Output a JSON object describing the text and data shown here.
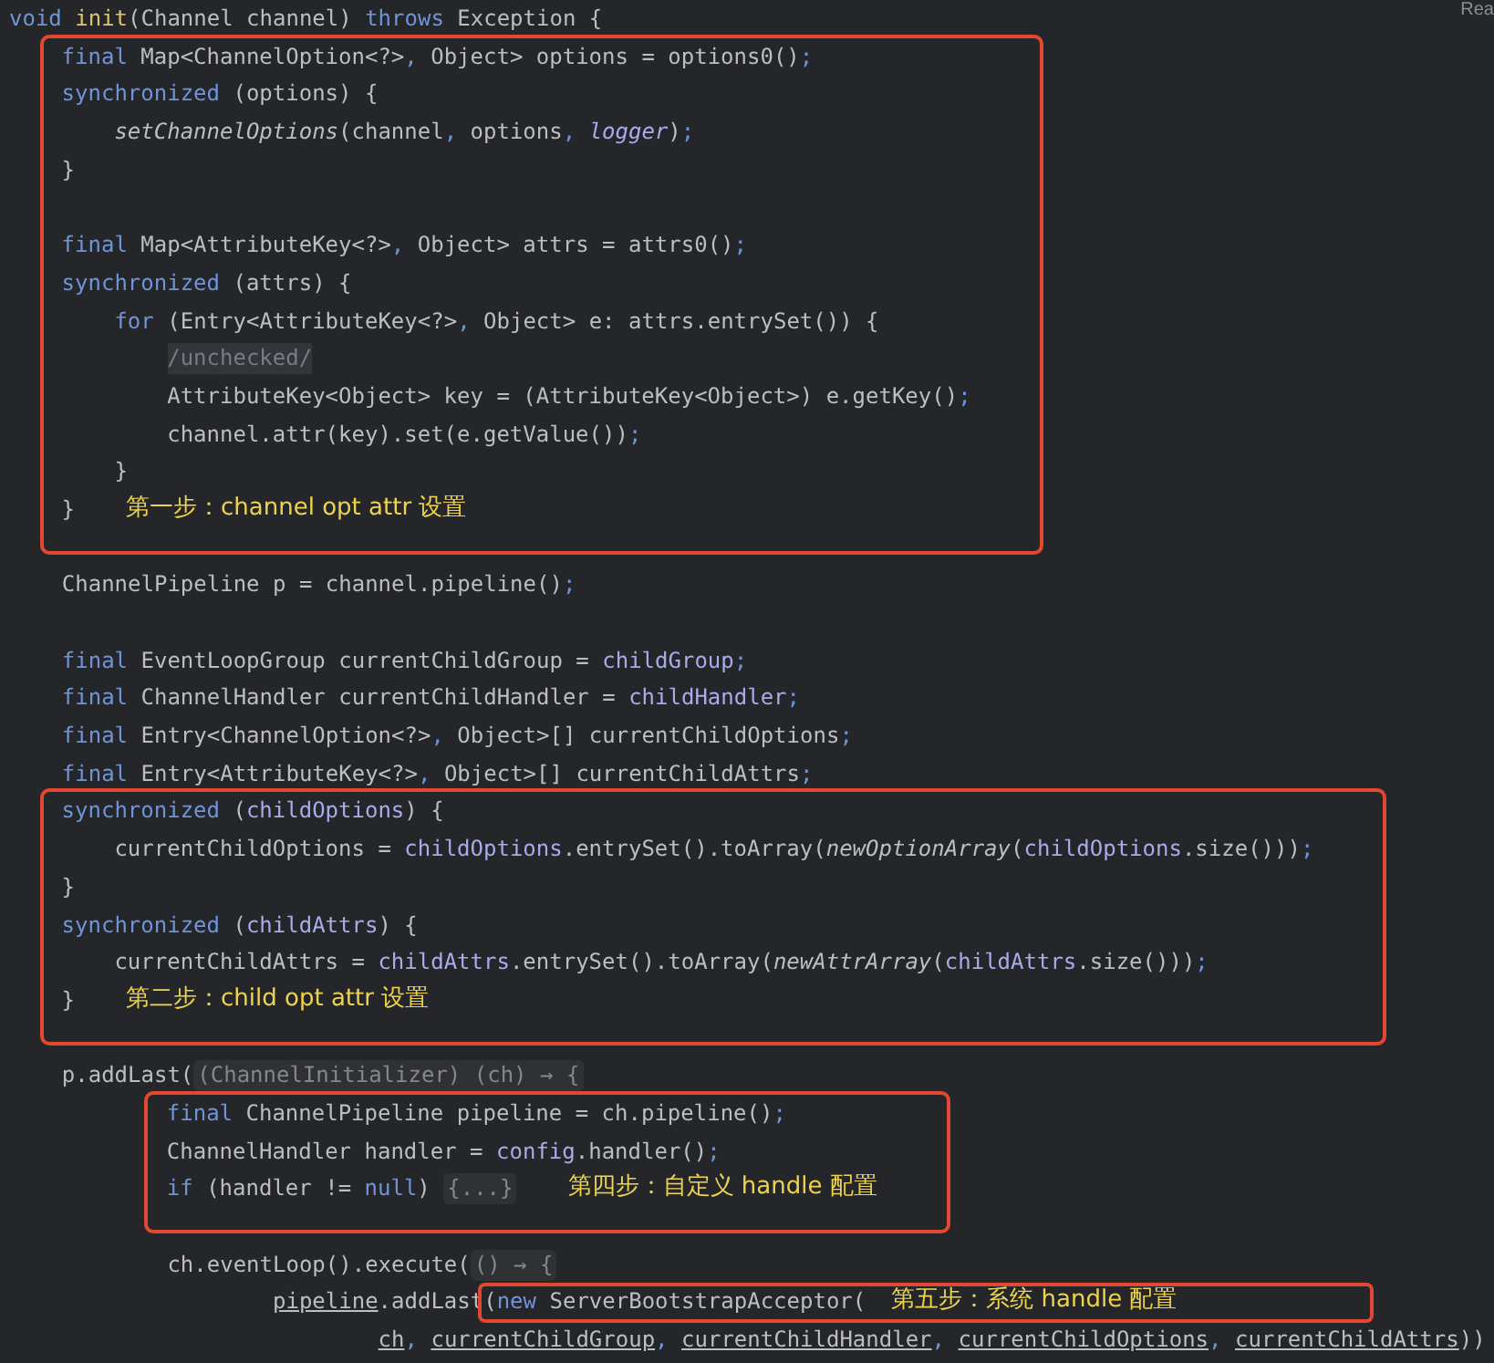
{
  "reader_mode_label": "Rea",
  "blocks": [
    {
      "kind": "plain",
      "lines": [
        {
          "kind": "code",
          "tokens": [
            {
              "kind": "keyword",
              "text": "void"
            },
            {
              "kind": "decl",
              "text": " init"
            },
            {
              "kind": "plain",
              "text": "(Channel channel) "
            },
            {
              "kind": "keyword",
              "text": "throws"
            },
            {
              "kind": "plain",
              "text": " Exception {"
            }
          ]
        }
      ]
    },
    {
      "kind": "annotated",
      "lines": [
        {
          "kind": "code",
          "tokens": [
            {
              "kind": "keyword",
              "text": "    final"
            },
            {
              "kind": "plain",
              "text": " Map<ChannelOption<?>"
            },
            {
              "kind": "punct",
              "text": ","
            },
            {
              "kind": "plain",
              "text": " Object> options = options0()"
            },
            {
              "kind": "punct",
              "text": ";"
            }
          ]
        },
        {
          "kind": "code",
          "tokens": [
            {
              "kind": "keyword",
              "text": "    synchronized"
            },
            {
              "kind": "plain",
              "text": " (options) {"
            }
          ]
        },
        {
          "kind": "code",
          "tokens": [
            {
              "kind": "method_italic",
              "text": "        setChannelOptions"
            },
            {
              "kind": "plain",
              "text": "(channel"
            },
            {
              "kind": "punct",
              "text": ","
            },
            {
              "kind": "plain",
              "text": " options"
            },
            {
              "kind": "punct",
              "text": ","
            },
            {
              "kind": "field_italic",
              "text": " logger"
            },
            {
              "kind": "plain",
              "text": ")"
            },
            {
              "kind": "punct",
              "text": ";"
            }
          ]
        },
        {
          "kind": "code",
          "tokens": [
            {
              "kind": "plain",
              "text": "    }"
            }
          ]
        },
        {
          "kind": "blank"
        },
        {
          "kind": "code",
          "tokens": [
            {
              "kind": "keyword",
              "text": "    final"
            },
            {
              "kind": "plain",
              "text": " Map<AttributeKey<?>"
            },
            {
              "kind": "punct",
              "text": ","
            },
            {
              "kind": "plain",
              "text": " Object> attrs = attrs0()"
            },
            {
              "kind": "punct",
              "text": ";"
            }
          ]
        },
        {
          "kind": "code",
          "tokens": [
            {
              "kind": "keyword",
              "text": "    synchronized"
            },
            {
              "kind": "plain",
              "text": " (attrs) {"
            }
          ]
        },
        {
          "kind": "code",
          "tokens": [
            {
              "kind": "keyword",
              "text": "        for"
            },
            {
              "kind": "plain",
              "text": " (Entry<AttributeKey<?>"
            },
            {
              "kind": "punct",
              "text": ","
            },
            {
              "kind": "plain",
              "text": " Object> e: attrs.entrySet()) {"
            }
          ]
        },
        {
          "kind": "code",
          "tokens": [
            {
              "kind": "comment",
              "text": "            /unchecked/"
            }
          ]
        },
        {
          "kind": "code",
          "tokens": [
            {
              "kind": "plain",
              "text": "            AttributeKey<Object> key = (AttributeKey<Object>) e.getKey()"
            },
            {
              "kind": "punct",
              "text": ";"
            }
          ]
        },
        {
          "kind": "code",
          "tokens": [
            {
              "kind": "plain",
              "text": "            channel.attr(key).set(e.getValue())"
            },
            {
              "kind": "punct",
              "text": ";"
            }
          ]
        },
        {
          "kind": "code",
          "tokens": [
            {
              "kind": "plain",
              "text": "        }"
            }
          ]
        },
        {
          "kind": "code",
          "tokens": [
            {
              "kind": "plain",
              "text": "    }"
            },
            {
              "kind": "note",
              "text": "第一步：channel opt attr 设置"
            }
          ]
        }
      ]
    },
    {
      "kind": "plain",
      "lines": [
        {
          "kind": "blank"
        },
        {
          "kind": "code",
          "tokens": [
            {
              "kind": "plain",
              "text": "    ChannelPipeline p = channel.pipeline()"
            },
            {
              "kind": "punct",
              "text": ";"
            }
          ]
        },
        {
          "kind": "blank"
        },
        {
          "kind": "code",
          "tokens": [
            {
              "kind": "keyword",
              "text": "    final"
            },
            {
              "kind": "plain",
              "text": " EventLoopGroup currentChildGroup = "
            },
            {
              "kind": "field",
              "text": "childGroup"
            },
            {
              "kind": "punct",
              "text": ";"
            }
          ]
        },
        {
          "kind": "code",
          "tokens": [
            {
              "kind": "keyword",
              "text": "    final"
            },
            {
              "kind": "plain",
              "text": " ChannelHandler currentChildHandler = "
            },
            {
              "kind": "field",
              "text": "childHandler"
            },
            {
              "kind": "punct",
              "text": ";"
            }
          ]
        },
        {
          "kind": "code",
          "tokens": [
            {
              "kind": "keyword",
              "text": "    final"
            },
            {
              "kind": "plain",
              "text": " Entry<ChannelOption<?>"
            },
            {
              "kind": "punct",
              "text": ","
            },
            {
              "kind": "plain",
              "text": " Object>[] currentChildOptions"
            },
            {
              "kind": "punct",
              "text": ";"
            }
          ]
        },
        {
          "kind": "code",
          "tokens": [
            {
              "kind": "keyword",
              "text": "    final"
            },
            {
              "kind": "plain",
              "text": " Entry<AttributeKey<?>"
            },
            {
              "kind": "punct",
              "text": ","
            },
            {
              "kind": "plain",
              "text": " Object>[] currentChildAttrs"
            },
            {
              "kind": "punct",
              "text": ";"
            }
          ]
        }
      ]
    },
    {
      "kind": "annotated",
      "lines": [
        {
          "kind": "code",
          "tokens": [
            {
              "kind": "keyword",
              "text": "    synchronized"
            },
            {
              "kind": "plain",
              "text": " ("
            },
            {
              "kind": "field",
              "text": "childOptions"
            },
            {
              "kind": "plain",
              "text": ") {"
            }
          ]
        },
        {
          "kind": "code",
          "tokens": [
            {
              "kind": "plain",
              "text": "        currentChildOptions = "
            },
            {
              "kind": "field",
              "text": "childOptions"
            },
            {
              "kind": "plain",
              "text": ".entrySet().toArray("
            },
            {
              "kind": "method_italic",
              "text": "newOptionArray"
            },
            {
              "kind": "plain",
              "text": "("
            },
            {
              "kind": "field",
              "text": "childOptions"
            },
            {
              "kind": "plain",
              "text": ".size()))"
            },
            {
              "kind": "punct",
              "text": ";"
            }
          ]
        },
        {
          "kind": "code",
          "tokens": [
            {
              "kind": "plain",
              "text": "    }"
            }
          ]
        },
        {
          "kind": "code",
          "tokens": [
            {
              "kind": "keyword",
              "text": "    synchronized"
            },
            {
              "kind": "plain",
              "text": " ("
            },
            {
              "kind": "field",
              "text": "childAttrs"
            },
            {
              "kind": "plain",
              "text": ") {"
            }
          ]
        },
        {
          "kind": "code",
          "tokens": [
            {
              "kind": "plain",
              "text": "        currentChildAttrs = "
            },
            {
              "kind": "field",
              "text": "childAttrs"
            },
            {
              "kind": "plain",
              "text": ".entrySet().toArray("
            },
            {
              "kind": "method_italic",
              "text": "newAttrArray"
            },
            {
              "kind": "plain",
              "text": "("
            },
            {
              "kind": "field",
              "text": "childAttrs"
            },
            {
              "kind": "plain",
              "text": ".size()))"
            },
            {
              "kind": "punct",
              "text": ";"
            }
          ]
        },
        {
          "kind": "code",
          "tokens": [
            {
              "kind": "plain",
              "text": "    }"
            },
            {
              "kind": "note",
              "text": "第二步：child opt attr 设置"
            }
          ]
        }
      ]
    },
    {
      "kind": "plain",
      "lines": [
        {
          "kind": "blank"
        },
        {
          "kind": "code",
          "tokens": [
            {
              "kind": "plain",
              "text": "    p.addLast("
            },
            {
              "kind": "hint",
              "text": "(ChannelInitializer) (ch) → {"
            }
          ]
        }
      ]
    },
    {
      "kind": "annotated",
      "lines": [
        {
          "kind": "code",
          "tokens": [
            {
              "kind": "keyword",
              "text": "            final"
            },
            {
              "kind": "plain",
              "text": " ChannelPipeline pipeline = ch.pipeline()"
            },
            {
              "kind": "punct",
              "text": ";"
            }
          ]
        },
        {
          "kind": "code",
          "tokens": [
            {
              "kind": "plain",
              "text": "            ChannelHandler handler = "
            },
            {
              "kind": "field",
              "text": "config"
            },
            {
              "kind": "plain",
              "text": ".handler()"
            },
            {
              "kind": "punct",
              "text": ";"
            }
          ]
        },
        {
          "kind": "code",
          "tokens": [
            {
              "kind": "keyword",
              "text": "            if"
            },
            {
              "kind": "plain",
              "text": " (handler != "
            },
            {
              "kind": "keyword",
              "text": "null"
            },
            {
              "kind": "plain",
              "text": ") "
            },
            {
              "kind": "fold",
              "text": "{...}"
            },
            {
              "kind": "note",
              "text": "第四步：自定义 handle 配置"
            }
          ]
        }
      ]
    },
    {
      "kind": "plain",
      "lines": [
        {
          "kind": "blank"
        },
        {
          "kind": "code",
          "tokens": [
            {
              "kind": "plain",
              "text": "            ch.eventLoop().execute("
            },
            {
              "kind": "hint",
              "text": "() → {"
            }
          ]
        },
        {
          "kind": "code",
          "tokens": [
            {
              "kind": "captured",
              "text": "                    pipeline"
            },
            {
              "kind": "plain",
              "text": ".addLast"
            }
          ],
          "boxed_tokens": [
            {
              "kind": "plain",
              "text": "("
            },
            {
              "kind": "keyword",
              "text": "new"
            },
            {
              "kind": "plain",
              "text": " ServerBootstrapAcceptor("
            },
            {
              "kind": "note",
              "text": "第五步：系统 handle 配置"
            }
          ]
        },
        {
          "kind": "code",
          "tokens": [
            {
              "kind": "captured",
              "text": "                            ch"
            },
            {
              "kind": "punct",
              "text": ","
            },
            {
              "kind": "captured",
              "text": " currentChildGroup"
            },
            {
              "kind": "punct",
              "text": ","
            },
            {
              "kind": "captured",
              "text": " currentChildHandler"
            },
            {
              "kind": "punct",
              "text": ","
            },
            {
              "kind": "captured",
              "text": " currentChildOptions"
            },
            {
              "kind": "punct",
              "text": ","
            },
            {
              "kind": "captured",
              "text": " currentChildAttrs"
            },
            {
              "kind": "plain",
              "text": "))"
            }
          ]
        }
      ]
    }
  ]
}
